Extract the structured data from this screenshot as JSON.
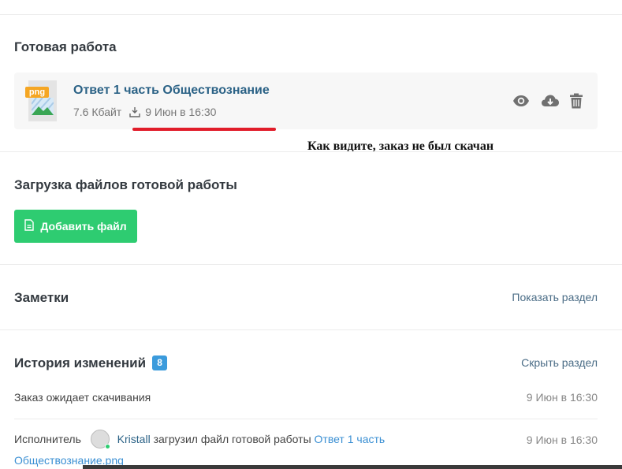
{
  "ready_work": {
    "title": "Готовая работа",
    "file": {
      "name": "Ответ 1 часть Обществознание",
      "type_badge": "png",
      "size": "7.6 Кбайт",
      "uploaded": "9 Июн в 16:30",
      "actions": [
        "eye-icon",
        "cloud-download-icon",
        "trash-icon"
      ]
    }
  },
  "annotation": "Как видите, заказ не был скачан",
  "upload": {
    "title": "Загрузка файлов готовой работы",
    "add_button": "Добавить файл"
  },
  "notes": {
    "title": "Заметки",
    "toggle": "Показать раздел"
  },
  "history": {
    "title": "История изменений",
    "count": "8",
    "toggle": "Скрыть раздел",
    "entries": [
      {
        "text": "Заказ ожидает скачивания",
        "time": "9 Июн в 16:30"
      },
      {
        "prefix": "Исполнитель",
        "user": "Kristall",
        "action": "загрузил файл готовой работы",
        "link_part1": "Ответ 1 часть",
        "link_part2": "Обществознание.png",
        "time": "9 Июн в 16:30"
      }
    ]
  },
  "colors": {
    "accent_green": "#2ecc71",
    "link_blue": "#2b6286",
    "badge_blue": "#3b9bdc",
    "underline_red": "#e11d2a"
  }
}
